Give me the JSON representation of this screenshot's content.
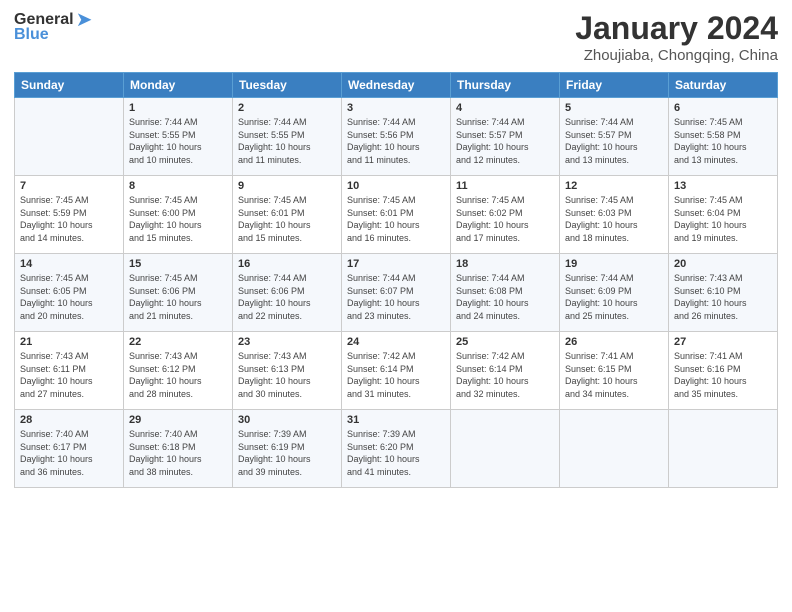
{
  "header": {
    "logo_general": "General",
    "logo_blue": "Blue",
    "month_title": "January 2024",
    "subtitle": "Zhoujiaba, Chongqing, China"
  },
  "weekdays": [
    "Sunday",
    "Monday",
    "Tuesday",
    "Wednesday",
    "Thursday",
    "Friday",
    "Saturday"
  ],
  "weeks": [
    [
      {
        "day": "",
        "info": ""
      },
      {
        "day": "1",
        "info": "Sunrise: 7:44 AM\nSunset: 5:55 PM\nDaylight: 10 hours\nand 10 minutes."
      },
      {
        "day": "2",
        "info": "Sunrise: 7:44 AM\nSunset: 5:55 PM\nDaylight: 10 hours\nand 11 minutes."
      },
      {
        "day": "3",
        "info": "Sunrise: 7:44 AM\nSunset: 5:56 PM\nDaylight: 10 hours\nand 11 minutes."
      },
      {
        "day": "4",
        "info": "Sunrise: 7:44 AM\nSunset: 5:57 PM\nDaylight: 10 hours\nand 12 minutes."
      },
      {
        "day": "5",
        "info": "Sunrise: 7:44 AM\nSunset: 5:57 PM\nDaylight: 10 hours\nand 13 minutes."
      },
      {
        "day": "6",
        "info": "Sunrise: 7:45 AM\nSunset: 5:58 PM\nDaylight: 10 hours\nand 13 minutes."
      }
    ],
    [
      {
        "day": "7",
        "info": "Sunrise: 7:45 AM\nSunset: 5:59 PM\nDaylight: 10 hours\nand 14 minutes."
      },
      {
        "day": "8",
        "info": "Sunrise: 7:45 AM\nSunset: 6:00 PM\nDaylight: 10 hours\nand 15 minutes."
      },
      {
        "day": "9",
        "info": "Sunrise: 7:45 AM\nSunset: 6:01 PM\nDaylight: 10 hours\nand 15 minutes."
      },
      {
        "day": "10",
        "info": "Sunrise: 7:45 AM\nSunset: 6:01 PM\nDaylight: 10 hours\nand 16 minutes."
      },
      {
        "day": "11",
        "info": "Sunrise: 7:45 AM\nSunset: 6:02 PM\nDaylight: 10 hours\nand 17 minutes."
      },
      {
        "day": "12",
        "info": "Sunrise: 7:45 AM\nSunset: 6:03 PM\nDaylight: 10 hours\nand 18 minutes."
      },
      {
        "day": "13",
        "info": "Sunrise: 7:45 AM\nSunset: 6:04 PM\nDaylight: 10 hours\nand 19 minutes."
      }
    ],
    [
      {
        "day": "14",
        "info": "Sunrise: 7:45 AM\nSunset: 6:05 PM\nDaylight: 10 hours\nand 20 minutes."
      },
      {
        "day": "15",
        "info": "Sunrise: 7:45 AM\nSunset: 6:06 PM\nDaylight: 10 hours\nand 21 minutes."
      },
      {
        "day": "16",
        "info": "Sunrise: 7:44 AM\nSunset: 6:06 PM\nDaylight: 10 hours\nand 22 minutes."
      },
      {
        "day": "17",
        "info": "Sunrise: 7:44 AM\nSunset: 6:07 PM\nDaylight: 10 hours\nand 23 minutes."
      },
      {
        "day": "18",
        "info": "Sunrise: 7:44 AM\nSunset: 6:08 PM\nDaylight: 10 hours\nand 24 minutes."
      },
      {
        "day": "19",
        "info": "Sunrise: 7:44 AM\nSunset: 6:09 PM\nDaylight: 10 hours\nand 25 minutes."
      },
      {
        "day": "20",
        "info": "Sunrise: 7:43 AM\nSunset: 6:10 PM\nDaylight: 10 hours\nand 26 minutes."
      }
    ],
    [
      {
        "day": "21",
        "info": "Sunrise: 7:43 AM\nSunset: 6:11 PM\nDaylight: 10 hours\nand 27 minutes."
      },
      {
        "day": "22",
        "info": "Sunrise: 7:43 AM\nSunset: 6:12 PM\nDaylight: 10 hours\nand 28 minutes."
      },
      {
        "day": "23",
        "info": "Sunrise: 7:43 AM\nSunset: 6:13 PM\nDaylight: 10 hours\nand 30 minutes."
      },
      {
        "day": "24",
        "info": "Sunrise: 7:42 AM\nSunset: 6:14 PM\nDaylight: 10 hours\nand 31 minutes."
      },
      {
        "day": "25",
        "info": "Sunrise: 7:42 AM\nSunset: 6:14 PM\nDaylight: 10 hours\nand 32 minutes."
      },
      {
        "day": "26",
        "info": "Sunrise: 7:41 AM\nSunset: 6:15 PM\nDaylight: 10 hours\nand 34 minutes."
      },
      {
        "day": "27",
        "info": "Sunrise: 7:41 AM\nSunset: 6:16 PM\nDaylight: 10 hours\nand 35 minutes."
      }
    ],
    [
      {
        "day": "28",
        "info": "Sunrise: 7:40 AM\nSunset: 6:17 PM\nDaylight: 10 hours\nand 36 minutes."
      },
      {
        "day": "29",
        "info": "Sunrise: 7:40 AM\nSunset: 6:18 PM\nDaylight: 10 hours\nand 38 minutes."
      },
      {
        "day": "30",
        "info": "Sunrise: 7:39 AM\nSunset: 6:19 PM\nDaylight: 10 hours\nand 39 minutes."
      },
      {
        "day": "31",
        "info": "Sunrise: 7:39 AM\nSunset: 6:20 PM\nDaylight: 10 hours\nand 41 minutes."
      },
      {
        "day": "",
        "info": ""
      },
      {
        "day": "",
        "info": ""
      },
      {
        "day": "",
        "info": ""
      }
    ]
  ]
}
